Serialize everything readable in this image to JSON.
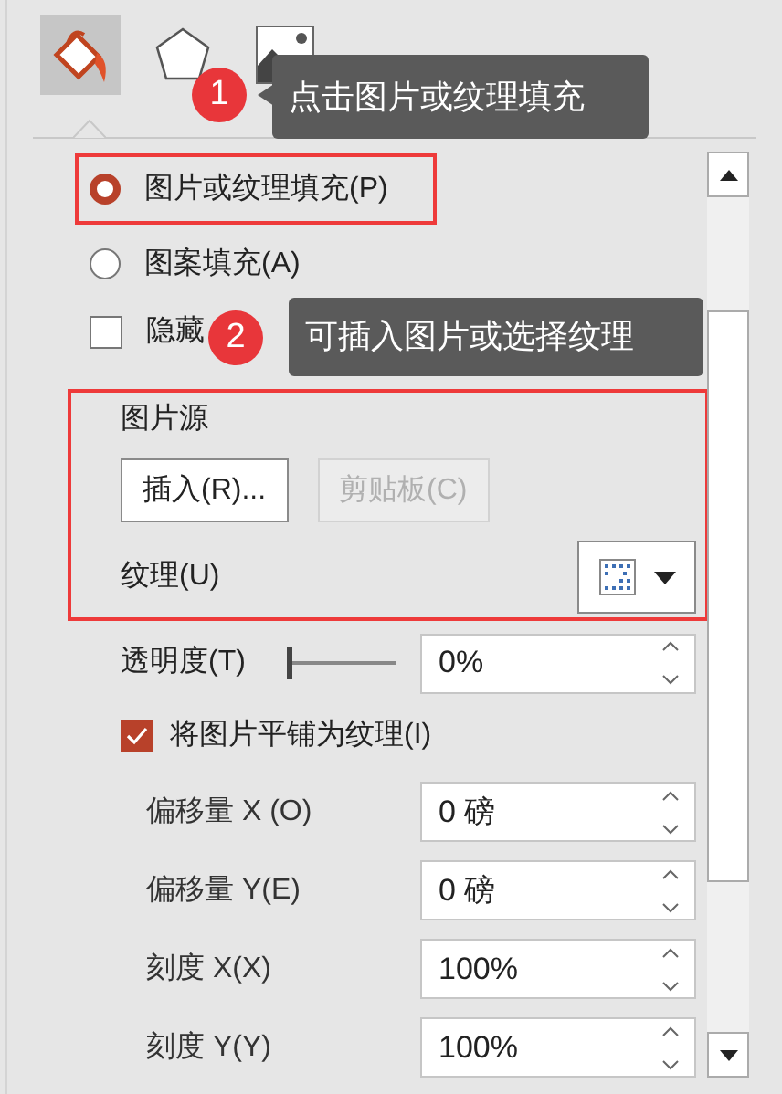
{
  "tabs": [
    {
      "kind": "fill",
      "selected": true
    },
    {
      "kind": "shape",
      "selected": false
    },
    {
      "kind": "picture",
      "selected": false
    }
  ],
  "callouts": [
    {
      "number": "1",
      "text": "点击图片或纹理填充"
    },
    {
      "number": "2",
      "text": "可插入图片或选择纹理"
    }
  ],
  "fill_options": [
    {
      "kind": "radio",
      "label": "图片或纹理填充(P)",
      "selected": true,
      "highlighted": true
    },
    {
      "kind": "radio",
      "label": "图案填充(A)",
      "selected": false,
      "highlighted": false
    },
    {
      "kind": "checkbox",
      "label": "隐藏",
      "checked": false,
      "highlighted": false
    }
  ],
  "picture_source": {
    "highlighted": true,
    "title": "图片源",
    "buttons": [
      {
        "label": "插入(R)...",
        "disabled": false
      },
      {
        "label": "剪贴板(C)",
        "disabled": true
      }
    ],
    "texture_label": "纹理(U)"
  },
  "transparency": {
    "label": "透明度(T)",
    "level": 0,
    "value": "0%"
  },
  "tile": {
    "label": "将图片平铺为纹理(I)",
    "checked": true
  },
  "offsets": [
    {
      "label": "偏移量 X (O)",
      "value": "0 磅"
    },
    {
      "label": "偏移量 Y(E)",
      "value": "0 磅"
    },
    {
      "label": "刻度 X(X)",
      "value": "100%"
    },
    {
      "label": "刻度 Y(Y)",
      "value": "100%"
    }
  ]
}
